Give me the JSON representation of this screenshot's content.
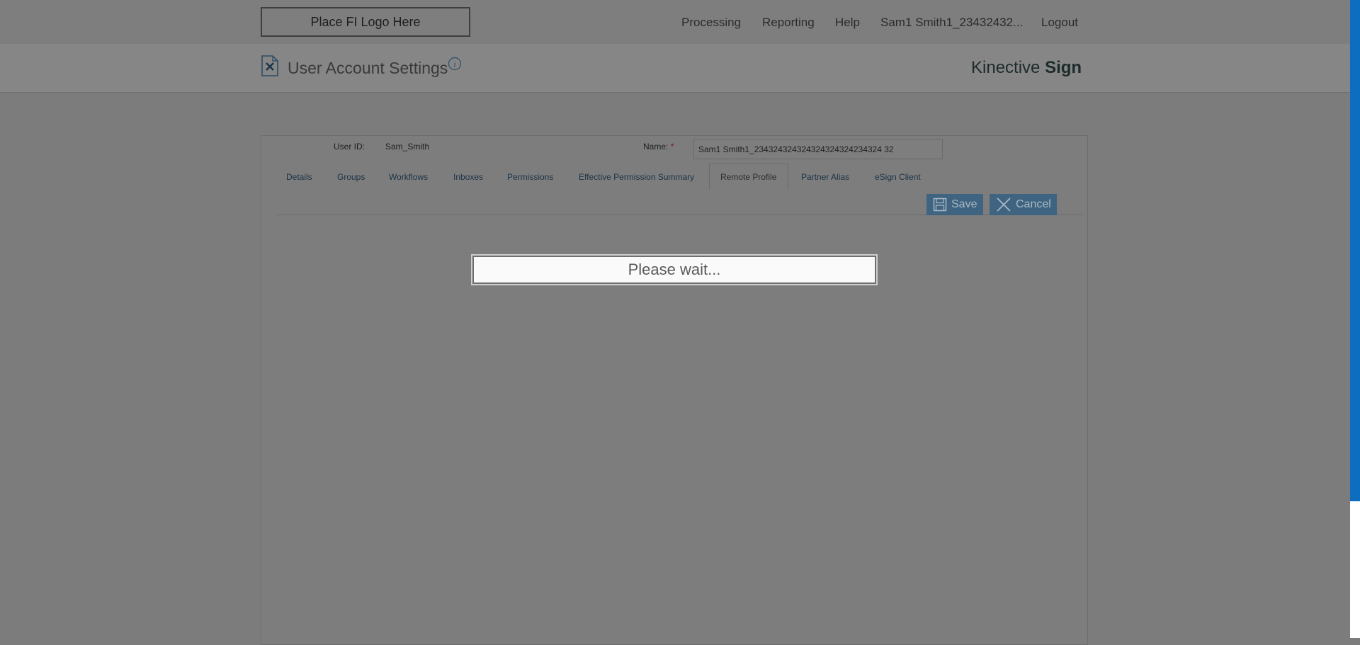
{
  "header": {
    "logo_text": "Place FI Logo Here",
    "nav": [
      "Processing",
      "Reporting",
      "Help",
      "Sam1 Smith1_23432432...",
      "Logout"
    ]
  },
  "subheader": {
    "title": "User Account Settings",
    "brand_prefix": "Kinective",
    "brand_suffix": "Sign"
  },
  "form": {
    "user_id_label": "User ID:",
    "user_id_value": "Sam_Smith",
    "name_label": "Name:",
    "required_mark": "*",
    "name_value": "Sam1 Smith1_234324324324324324324234324 32"
  },
  "tabs": [
    "Details",
    "Groups",
    "Workflows",
    "Inboxes",
    "Permissions",
    "Effective Permission Summary",
    "Remote Profile",
    "Partner Alias",
    "eSign Client"
  ],
  "active_tab": "Remote Profile",
  "actions": {
    "save_label": "Save",
    "cancel_label": "Cancel"
  },
  "overlay": {
    "message": "Please wait..."
  },
  "colors": {
    "accent": "#0f6dc0",
    "button": "#3e6481"
  }
}
